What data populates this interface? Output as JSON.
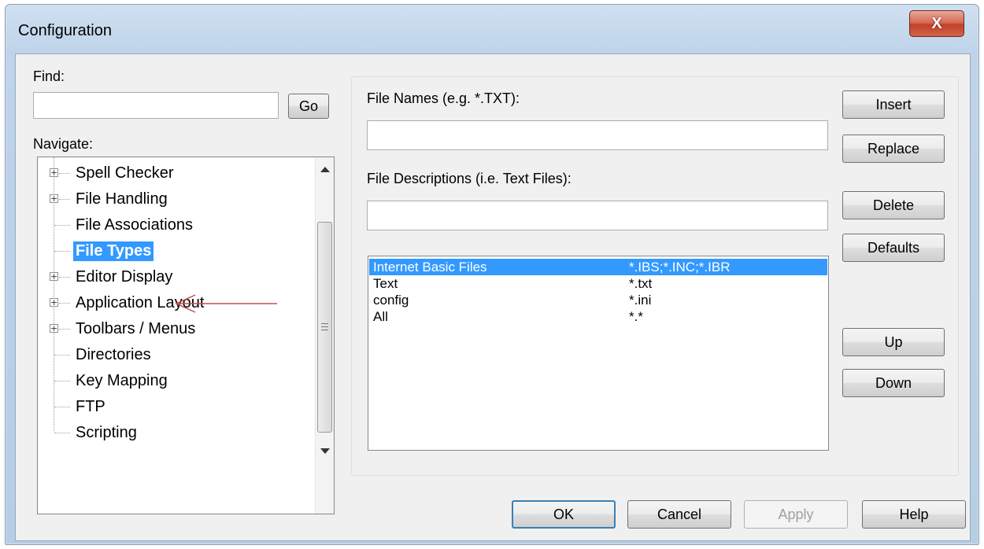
{
  "window": {
    "title": "Configuration",
    "close_glyph": "X"
  },
  "find": {
    "label": "Find:",
    "value": "",
    "go_label": "Go"
  },
  "navigate": {
    "label": "Navigate:",
    "items": [
      {
        "label": "Spell Checker",
        "expandable": true
      },
      {
        "label": "File Handling",
        "expandable": true
      },
      {
        "label": "File Associations",
        "expandable": false
      },
      {
        "label": "File Types",
        "expandable": false,
        "selected": true
      },
      {
        "label": "Editor Display",
        "expandable": true
      },
      {
        "label": "Application Layout",
        "expandable": true
      },
      {
        "label": "Toolbars / Menus",
        "expandable": true
      },
      {
        "label": "Directories",
        "expandable": false
      },
      {
        "label": "Key Mapping",
        "expandable": false
      },
      {
        "label": "FTP",
        "expandable": false
      },
      {
        "label": "Scripting",
        "expandable": false
      }
    ],
    "expander_glyph": "+"
  },
  "file_names": {
    "label": "File Names (e.g. *.TXT):",
    "value": ""
  },
  "file_descriptions": {
    "label": "File Descriptions (i.e. Text Files):",
    "value": ""
  },
  "file_types_list": [
    {
      "name": "Internet Basic Files",
      "pattern": "*.IBS;*.INC;*.IBR",
      "selected": true
    },
    {
      "name": "Text",
      "pattern": "*.txt",
      "selected": false
    },
    {
      "name": "config",
      "pattern": "*.ini",
      "selected": false
    },
    {
      "name": "All",
      "pattern": "*.*",
      "selected": false
    }
  ],
  "side_buttons": {
    "insert": "Insert",
    "replace": "Replace",
    "delete": "Delete",
    "defaults": "Defaults",
    "up": "Up",
    "down": "Down"
  },
  "footer_buttons": {
    "ok": "OK",
    "cancel": "Cancel",
    "apply": "Apply",
    "help": "Help"
  },
  "colors": {
    "selection": "#3399ff",
    "annotation_arrow": "#c0504d",
    "close_button": "#c1412b"
  }
}
